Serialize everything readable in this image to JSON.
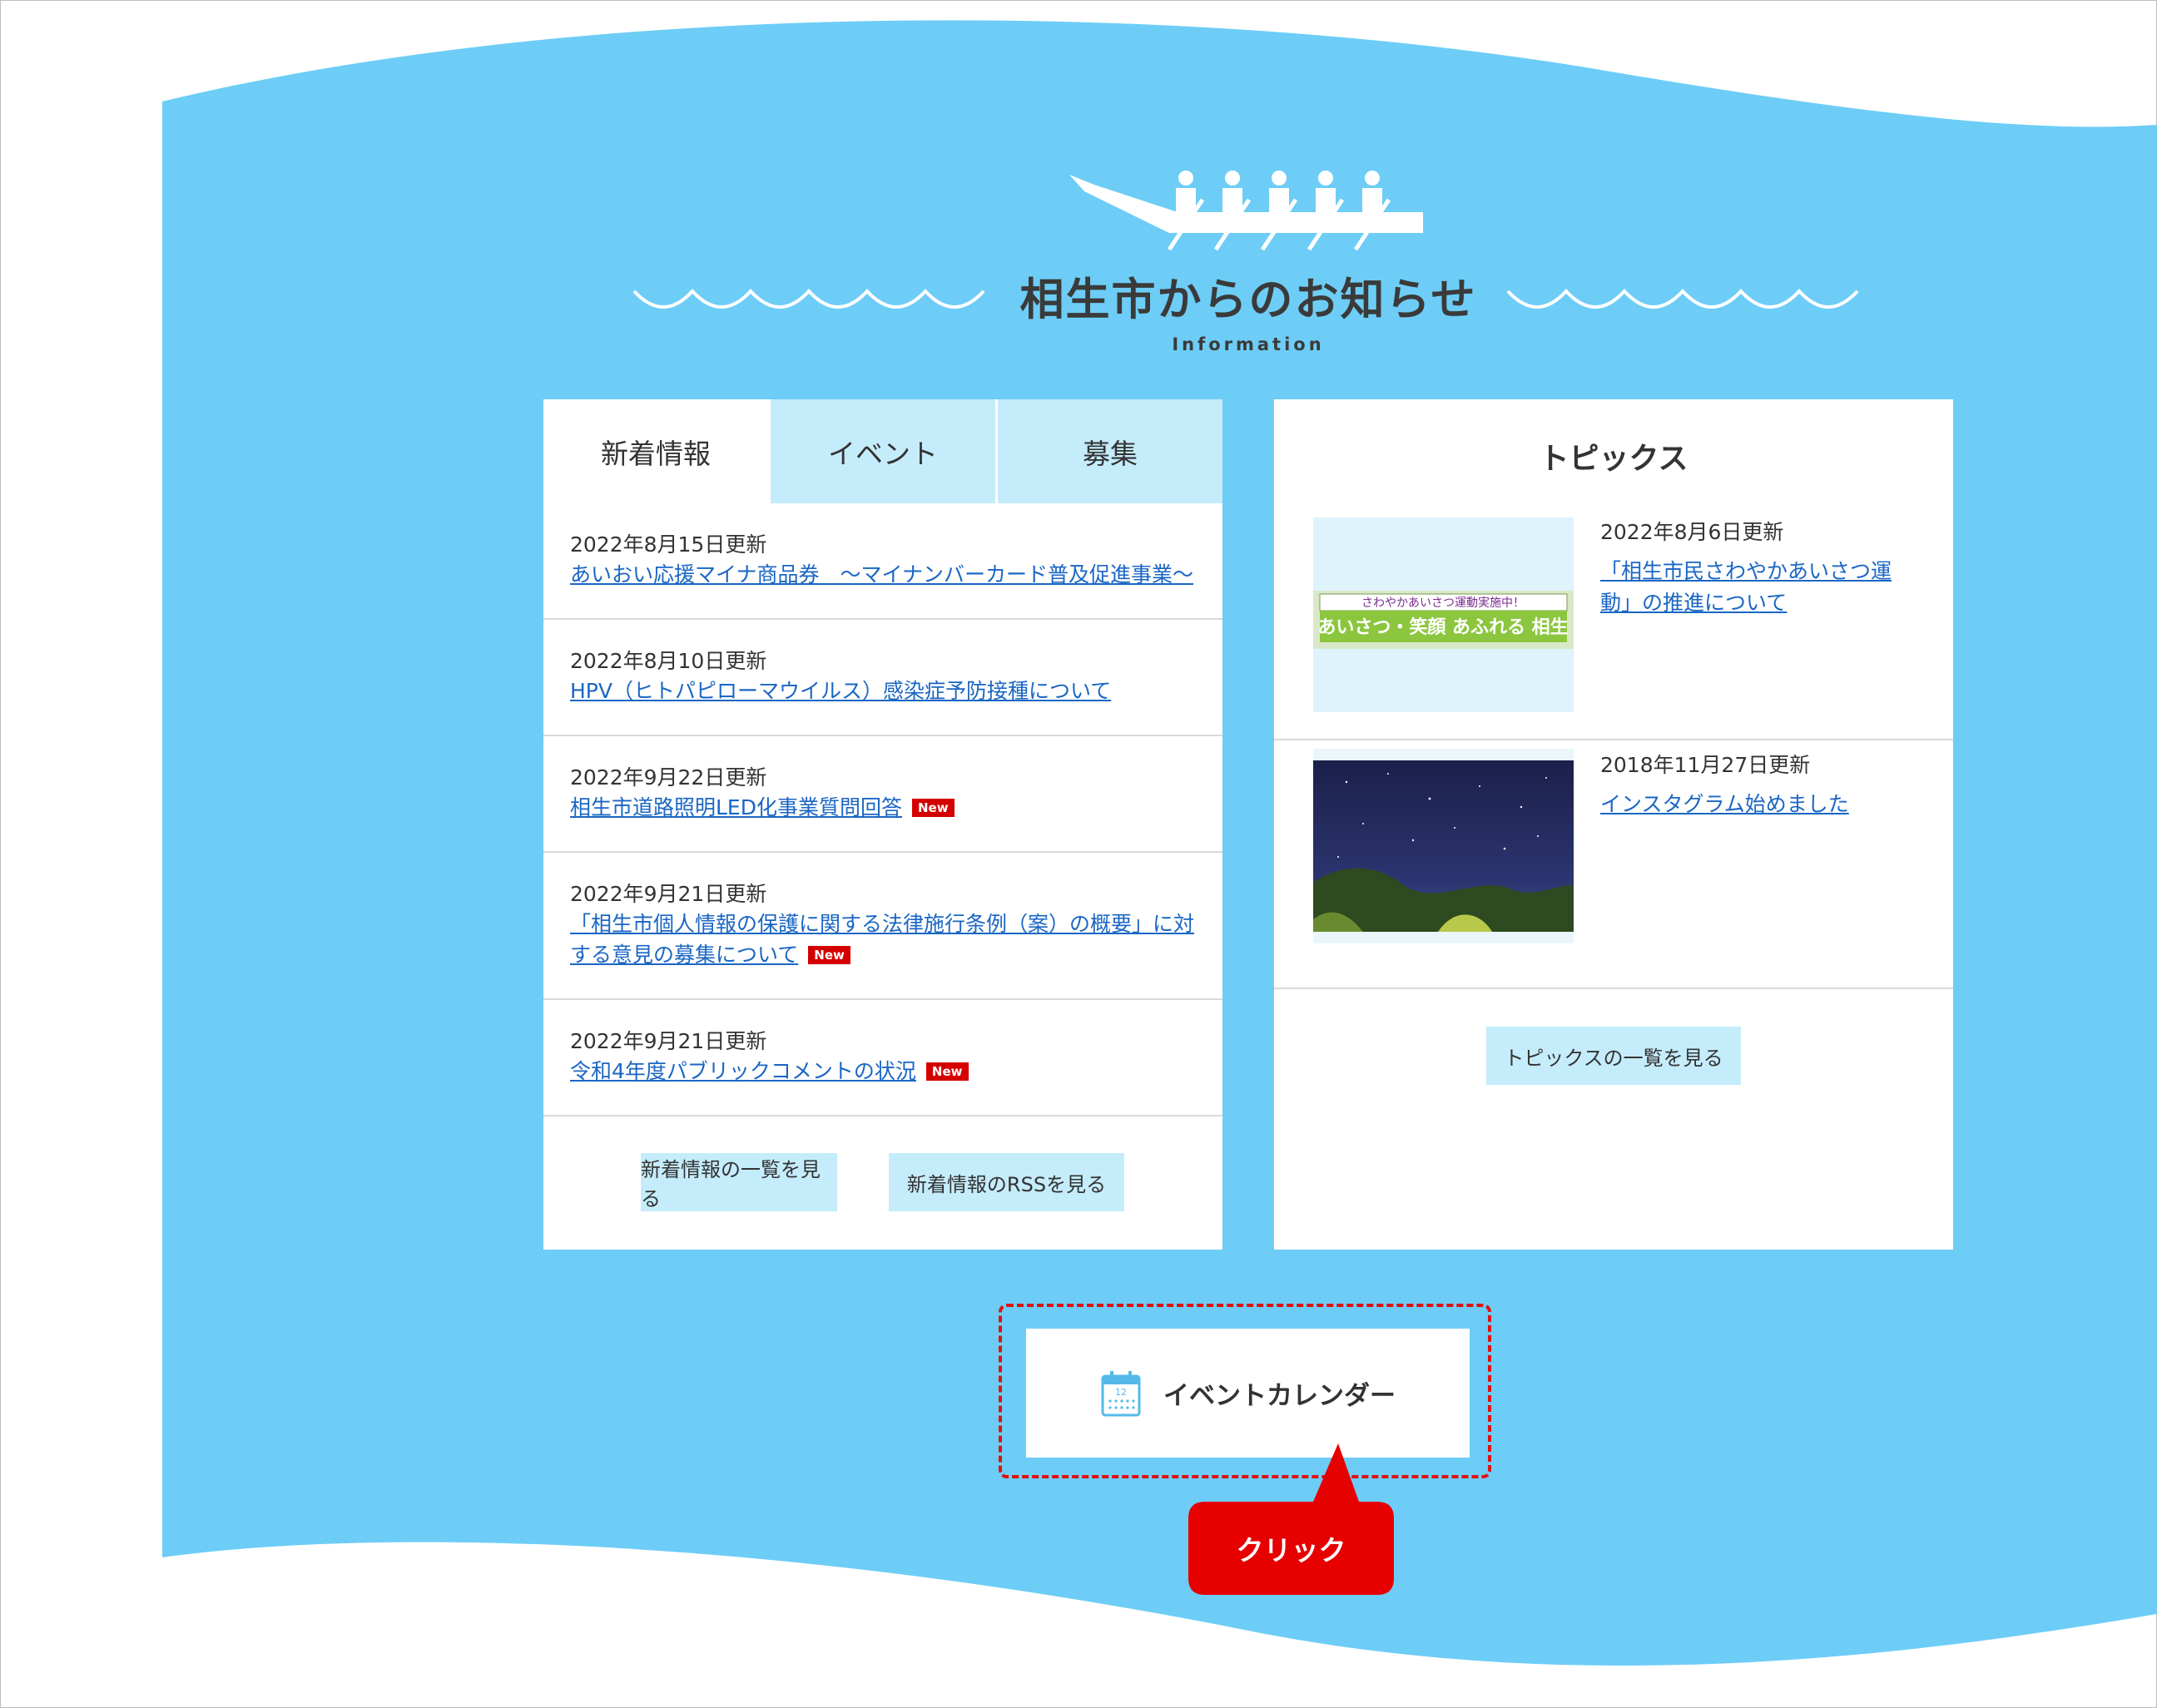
{
  "section": {
    "title": "相生市からのお知らせ",
    "subtitle": "Information"
  },
  "tabs": [
    {
      "label": "新着情報",
      "active": true
    },
    {
      "label": "イベント",
      "active": false
    },
    {
      "label": "募集",
      "active": false
    }
  ],
  "news": [
    {
      "date": "2022年8月15日更新",
      "title": "あいおい応援マイナ商品券　～マイナンバーカード普及促進事業～",
      "new": false
    },
    {
      "date": "2022年8月10日更新",
      "title": "HPV（ヒトパピローマウイルス）感染症予防接種について",
      "new": false
    },
    {
      "date": "2022年9月22日更新",
      "title": "相生市道路照明LED化事業質問回答",
      "new": true
    },
    {
      "date": "2022年9月21日更新",
      "title": "「相生市個人情報の保護に関する法律施行条例（案）の概要」に対する意見の募集について",
      "new": true
    },
    {
      "date": "2022年9月21日更新",
      "title": "令和4年度パブリックコメントの状況",
      "new": true
    }
  ],
  "new_badge": "New",
  "news_buttons": {
    "list": "新着情報の一覧を見る",
    "rss": "新着情報のRSSを見る"
  },
  "topics": {
    "title": "トピックス",
    "items": [
      {
        "date": "2022年8月6日更新",
        "title": "「相生市民さわやかあいさつ運動」の推進について",
        "banner_top": "さわやかあいさつ運動実施中！",
        "banner_main": "あいさつ・笑顔 あふれる 相生"
      },
      {
        "date": "2018年11月27日更新",
        "title": "インスタグラム始めました"
      }
    ],
    "list_button": "トピックスの一覧を見る"
  },
  "event_calendar": {
    "label": "イベントカレンダー",
    "icon": "calendar-icon",
    "icon_day": "12"
  },
  "callout": {
    "label": "クリック"
  },
  "colors": {
    "background_blue": "#6dcdf6",
    "tab_inactive": "#c5ecfb",
    "link": "#1a66c4",
    "new_badge": "#d40000",
    "callout_red": "#e60000"
  }
}
